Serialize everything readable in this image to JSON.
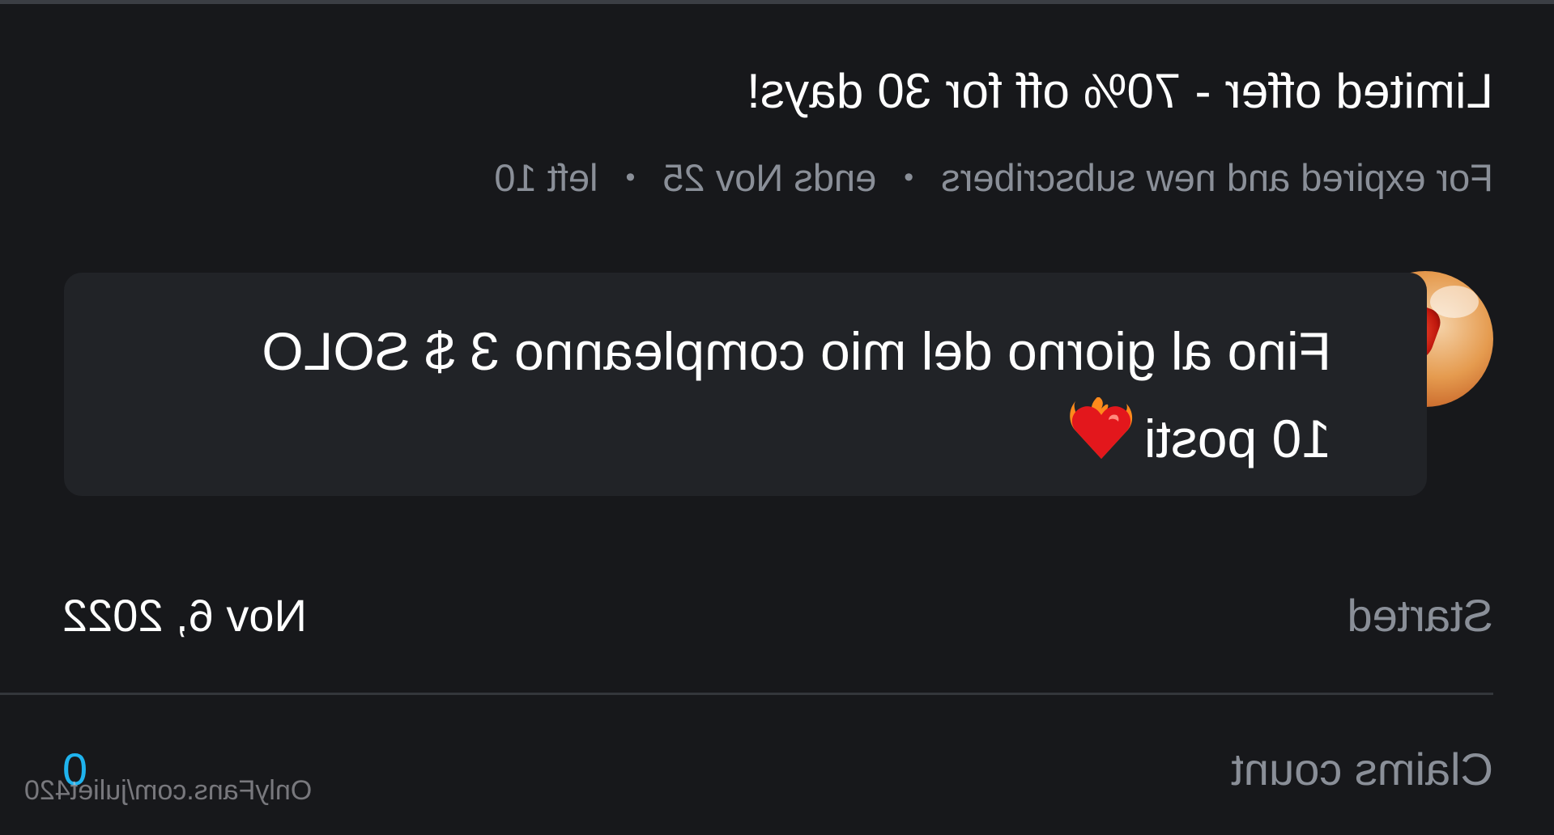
{
  "offer": {
    "title": "Limited offer - 70% off for 30 days!",
    "audience": "For expired and new subscribers",
    "ends": "ends Nov 25",
    "left": "left 10",
    "separator": "•"
  },
  "message": {
    "line1": "Fino al giorno del mio compleanno 3 $ SOLO",
    "line2": "10 posti",
    "emoji": "heart-on-fire"
  },
  "details": {
    "started_label": "Started",
    "started_value": "Nov 6, 2022",
    "claims_label": "Claims count",
    "claims_value": "0"
  },
  "watermark": "OnlyFans.com/juliet420",
  "colors": {
    "background": "#17181b",
    "bubble": "#212327",
    "muted_text": "#8a8f98",
    "link": "#1fb3ee"
  }
}
